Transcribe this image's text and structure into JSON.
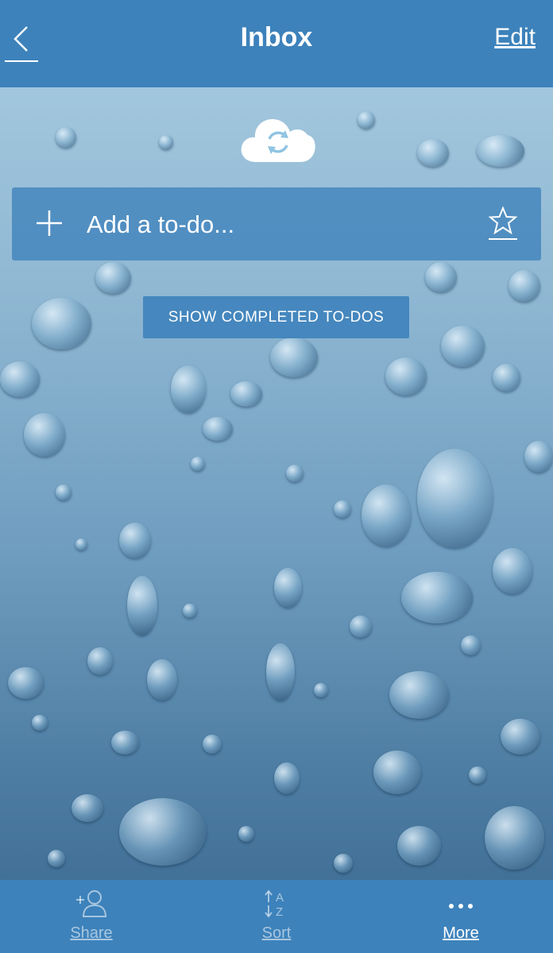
{
  "header": {
    "back_icon": "chevron-left-icon",
    "title": "Inbox",
    "edit_label": "Edit"
  },
  "sync": {
    "icon": "cloud-sync-icon"
  },
  "add_todo": {
    "plus_icon": "plus-icon",
    "placeholder": "Add a to-do...",
    "star_icon": "star-icon"
  },
  "show_completed_label": "SHOW COMPLETED TO-DOS",
  "tabbar": {
    "share": {
      "label": "Share",
      "icon": "add-person-icon"
    },
    "sort": {
      "label": "Sort",
      "icon": "sort-az-icon"
    },
    "more": {
      "label": "More",
      "icon": "ellipsis-icon"
    }
  },
  "colors": {
    "bar": "#3d82bb",
    "text": "#ffffff"
  }
}
